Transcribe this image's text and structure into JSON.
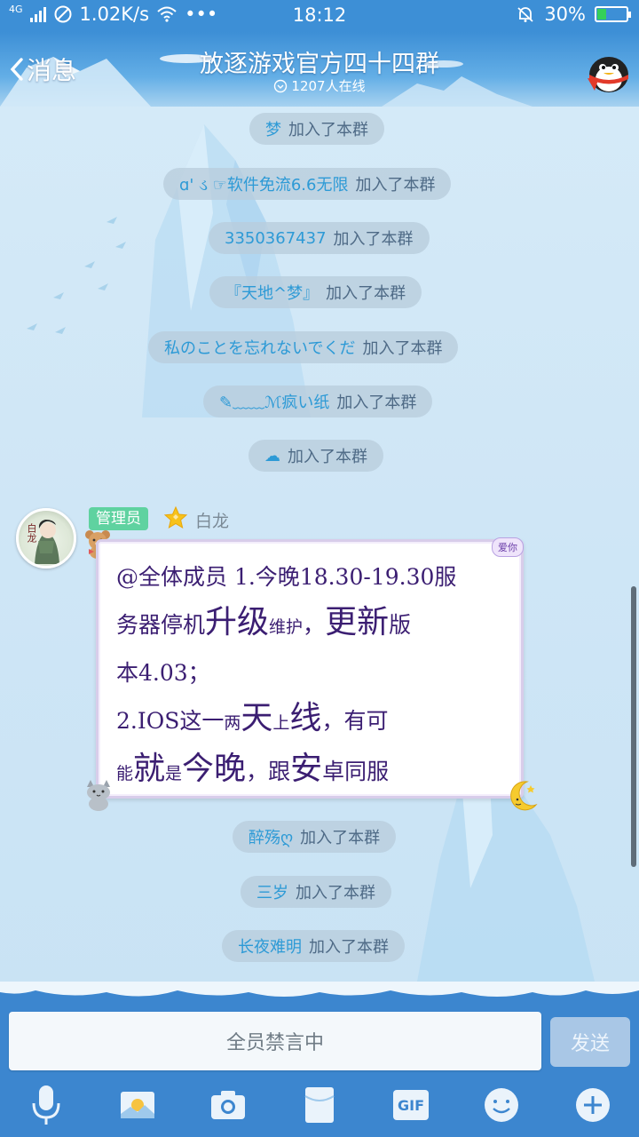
{
  "status_bar": {
    "network": "4G",
    "speed": "1.02K/s",
    "more": "•••",
    "time": "18:12",
    "battery": "30%",
    "battery_level": 0.3
  },
  "header": {
    "back_label": "消息",
    "title": "放逐游戏官方四十四群",
    "online": "1207人在线"
  },
  "system_suffix": "加入了本群",
  "system_messages": [
    {
      "nick": "梦"
    },
    {
      "nick": "ɑ' ડ ☞软件免流6.6无限"
    },
    {
      "nick": "3350367437"
    },
    {
      "nick": "『天地^梦』"
    },
    {
      "nick": "私のことを忘れないでくだ"
    },
    {
      "nick": "✎﹏﹏ℳ疯い纸"
    },
    {
      "nick": "☁"
    },
    {
      "nick": "醉殇ღ"
    },
    {
      "nick": "三岁"
    },
    {
      "nick": "长夜难明"
    }
  ],
  "message": {
    "avatar_text": "白龙",
    "badge": "管理员",
    "sender": "白龙",
    "sticker_text": "爱你",
    "text": {
      "l1": "@全体成员 1.今晚18.30-19.30服",
      "l2a": "务器停机",
      "l2b": "升级",
      "l2c": "维护",
      "l2d": "，",
      "l2e": "更新",
      "l2f": "版",
      "l3": "本4.03；",
      "l4a": "2.IOS这",
      "l4b": "一",
      "l4c": "两",
      "l4d": "天",
      "l4e": "上",
      "l4f": "线",
      "l4g": "，有可",
      "l5a": "能",
      "l5b": "就",
      "l5c": "是",
      "l5d": "今晚",
      "l5e": "，跟",
      "l5f": "安",
      "l5g": "卓同服"
    }
  },
  "input": {
    "mute_text": "全员禁言中",
    "send_label": "发送"
  },
  "toolbar": [
    {
      "icon": "microphone-icon"
    },
    {
      "icon": "photo-icon"
    },
    {
      "icon": "camera-icon"
    },
    {
      "icon": "red-packet-icon"
    },
    {
      "icon": "gif-icon",
      "label": "GIF"
    },
    {
      "icon": "emoji-icon"
    },
    {
      "icon": "plus-icon"
    }
  ]
}
